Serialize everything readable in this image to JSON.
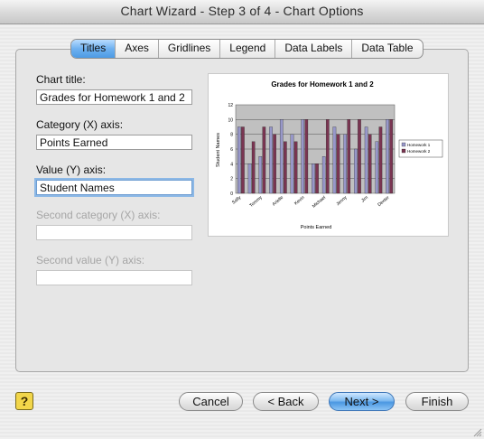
{
  "window": {
    "title": "Chart Wizard - Step 3 of 4 - Chart Options"
  },
  "tabs": [
    {
      "label": "Titles",
      "active": true
    },
    {
      "label": "Axes"
    },
    {
      "label": "Gridlines"
    },
    {
      "label": "Legend"
    },
    {
      "label": "Data Labels"
    },
    {
      "label": "Data Table"
    }
  ],
  "form": {
    "chart_title_label": "Chart title:",
    "chart_title_value": "Grades for Homework 1 and 2",
    "category_x_label": "Category (X) axis:",
    "category_x_value": "Points Earned",
    "value_y_label": "Value (Y) axis:",
    "value_y_value": "Student Names",
    "second_category_label": "Second category (X) axis:",
    "second_category_value": "",
    "second_value_label": "Second value (Y) axis:",
    "second_value_value": ""
  },
  "buttons": {
    "help": "?",
    "cancel": "Cancel",
    "back": "< Back",
    "next": "Next >",
    "finish": "Finish"
  },
  "chart_data": {
    "type": "bar",
    "title": "Grades for Homework 1 and 2",
    "xlabel": "Points Earned",
    "ylabel": "Student Names",
    "categories": [
      "Sally",
      "",
      "Tommy",
      "",
      "Arielle",
      "",
      "Kevin",
      "",
      "Michael",
      "",
      "Jenny",
      "",
      "Jim",
      "",
      "Dexter"
    ],
    "series": [
      {
        "name": "Homework 1",
        "values": [
          9,
          4,
          5,
          9,
          10,
          8,
          10,
          4,
          5,
          9,
          8,
          6,
          9,
          7,
          10
        ],
        "color": "#9797c9"
      },
      {
        "name": "Homework 2",
        "values": [
          9,
          7,
          9,
          8,
          7,
          7,
          10,
          4,
          10,
          8,
          10,
          10,
          8,
          9,
          10
        ],
        "color": "#7a3552"
      }
    ],
    "ylim": [
      0,
      12
    ],
    "yticks": [
      0,
      2,
      4,
      6,
      8,
      10,
      12
    ],
    "grid": true,
    "legend": "right",
    "plot_background": "#c0c0c0"
  }
}
